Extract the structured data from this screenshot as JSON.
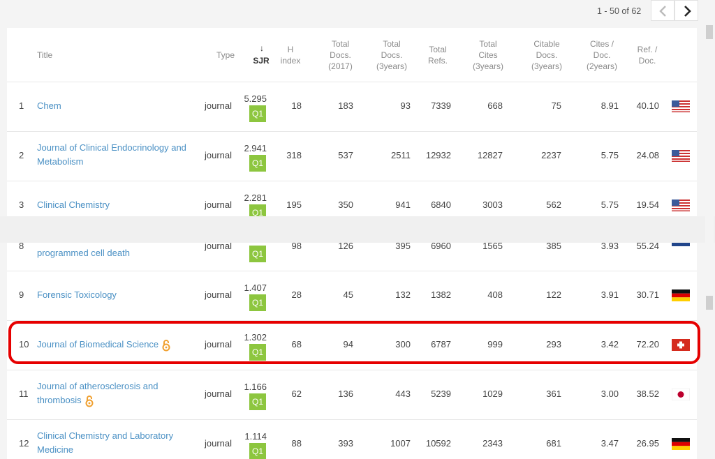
{
  "pager": {
    "range_text": "1 - 50 of 62"
  },
  "headers": {
    "title": "Title",
    "type": "Type",
    "sjr_arrow": "↓",
    "sjr": "SJR",
    "h": [
      "H",
      "index"
    ],
    "total_docs_year": [
      "Total",
      "Docs.",
      "(2017)"
    ],
    "total_docs_3y": [
      "Total",
      "Docs.",
      "(3years)"
    ],
    "total_refs": [
      "Total",
      "Refs."
    ],
    "total_cites_3y": [
      "Total",
      "Cites",
      "(3years)"
    ],
    "citable_docs_3y": [
      "Citable",
      "Docs.",
      "(3years)"
    ],
    "cites_per_doc": [
      "Cites /",
      "Doc.",
      "(2years)"
    ],
    "ref_per_doc": [
      "Ref. /",
      "Doc."
    ]
  },
  "rows_top": [
    {
      "rank": "1",
      "title": [
        "Chem"
      ],
      "type": "journal",
      "sjr": "5.295",
      "quartile": "Q1",
      "h": "18",
      "docs_year": "183",
      "docs_3y": "93",
      "refs": "7339",
      "cites_3y": "668",
      "citable_3y": "75",
      "cites_doc": "8.91",
      "ref_doc": "40.10",
      "country_flag": "us-flag-icon"
    },
    {
      "rank": "2",
      "title": [
        "Journal of Clinical Endocrinology and",
        "Metabolism"
      ],
      "type": "journal",
      "sjr": "2.941",
      "quartile": "Q1",
      "h": "318",
      "docs_year": "537",
      "docs_3y": "2511",
      "refs": "12932",
      "cites_3y": "12827",
      "citable_3y": "2237",
      "cites_doc": "5.75",
      "ref_doc": "24.08",
      "country_flag": "us-flag-icon"
    },
    {
      "rank": "3",
      "title": [
        "Clinical Chemistry"
      ],
      "type": "journal",
      "sjr": "2.281",
      "quartile": "Q1",
      "h": "195",
      "docs_year": "350",
      "docs_3y": "941",
      "refs": "6840",
      "cites_3y": "3003",
      "citable_3y": "562",
      "cites_doc": "5.75",
      "ref_doc": "19.54",
      "country_flag": "us-flag-icon"
    }
  ],
  "rows_bottom": [
    {
      "rank": "8",
      "title": [
        "programmed cell death"
      ],
      "type": "journal",
      "sjr": "",
      "quartile": "Q1",
      "h": "98",
      "docs_year": "126",
      "docs_3y": "395",
      "refs": "6960",
      "cites_3y": "1565",
      "citable_3y": "385",
      "cites_doc": "3.93",
      "ref_doc": "55.24",
      "country_flag": "nl-flag-icon"
    },
    {
      "rank": "9",
      "title": [
        "Forensic Toxicology"
      ],
      "type": "journal",
      "sjr": "1.407",
      "quartile": "Q1",
      "h": "28",
      "docs_year": "45",
      "docs_3y": "132",
      "refs": "1382",
      "cites_3y": "408",
      "citable_3y": "122",
      "cites_doc": "3.91",
      "ref_doc": "30.71",
      "country_flag": "de-flag-icon"
    },
    {
      "rank": "10",
      "title": [
        "Journal of Biomedical Science"
      ],
      "open_access": true,
      "type": "journal",
      "sjr": "1.302",
      "quartile": "Q1",
      "h": "68",
      "docs_year": "94",
      "docs_3y": "300",
      "refs": "6787",
      "cites_3y": "999",
      "citable_3y": "293",
      "cites_doc": "3.42",
      "ref_doc": "72.20",
      "country_flag": "ch-flag-icon"
    },
    {
      "rank": "11",
      "title": [
        "Journal of atherosclerosis and",
        "thrombosis"
      ],
      "open_access": true,
      "type": "journal",
      "sjr": "1.166",
      "quartile": "Q1",
      "h": "62",
      "docs_year": "136",
      "docs_3y": "443",
      "refs": "5239",
      "cites_3y": "1029",
      "citable_3y": "361",
      "cites_doc": "3.00",
      "ref_doc": "38.52",
      "country_flag": "jp-flag-icon"
    },
    {
      "rank": "12",
      "title": [
        "Clinical Chemistry and Laboratory",
        "Medicine"
      ],
      "type": "journal",
      "sjr": "1.114",
      "quartile": "Q1",
      "h": "88",
      "docs_year": "393",
      "docs_3y": "1007",
      "refs": "10592",
      "cites_3y": "2343",
      "citable_3y": "681",
      "cites_doc": "3.47",
      "ref_doc": "26.95",
      "country_flag": "de-flag-icon"
    }
  ],
  "colors": {
    "link": "#4a90c4",
    "quartile_q1": "#8dc63f",
    "highlight_border": "#e60000",
    "open_access_icon": "#f0a030"
  }
}
